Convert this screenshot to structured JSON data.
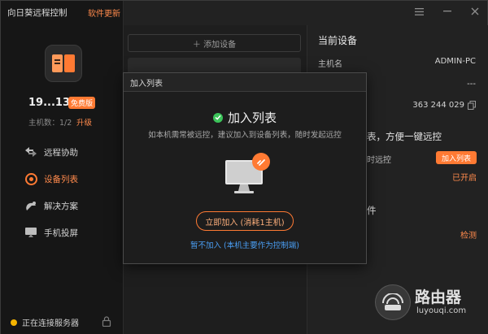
{
  "app": {
    "title": "向日葵远程控制",
    "update_label": "软件更新"
  },
  "account": {
    "device_code": "19...13",
    "edition_badge": "免费版",
    "host_count": "主机数：1/2",
    "upgrade_label": "升级"
  },
  "nav": {
    "items": [
      {
        "label": "远程协助",
        "icon": "remote-assist-icon"
      },
      {
        "label": "设备列表",
        "icon": "device-list-icon",
        "active": true
      },
      {
        "label": "解决方案",
        "icon": "solution-icon"
      },
      {
        "label": "手机投屏",
        "icon": "screen-cast-icon"
      }
    ]
  },
  "status": {
    "connection": "正在连接服务器"
  },
  "middle": {
    "add_device": "＋ 添加设备"
  },
  "right": {
    "title": "当前设备",
    "hostname_label": "主机名",
    "hostname_value": "ADMIN-PC",
    "dashes": "---",
    "id_value": "363 244 029",
    "promo_heading": "表，方便一键远控",
    "remote_label": "时远控",
    "join_btn": "加入列表",
    "status_on": "已开启",
    "component_label": "件",
    "check_link": "检测"
  },
  "watermark": {
    "text": "路由器",
    "url": "luyouqi.com"
  },
  "modal": {
    "titlebar": "加入列表",
    "heading": "加入列表",
    "description": "如本机需常被远控，建议加入到设备列表，随时发起远控",
    "primary_button": "立即加入 (消耗1主机)",
    "secondary_link": "暂不加入 (本机主要作为控制端)"
  },
  "colors": {
    "accent": "#ff7a33",
    "link": "#4a9ff5",
    "success": "#3cc45a",
    "status_dot": "#f5b400"
  }
}
